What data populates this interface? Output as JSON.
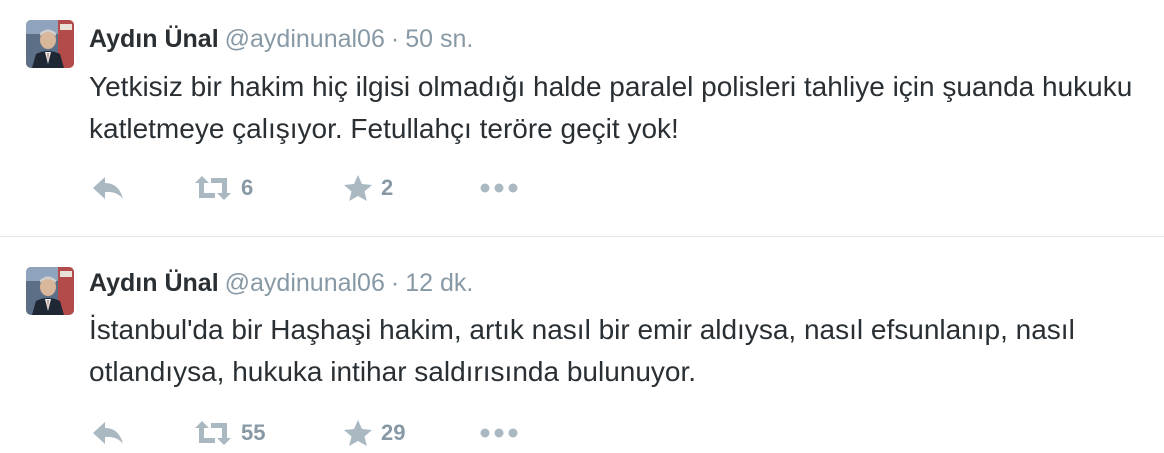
{
  "tweets": [
    {
      "fullname": "Aydın Ünal",
      "username": "@aydinunal06",
      "separator": "·",
      "time": "50 sn.",
      "text": "Yetkisiz bir hakim hiç ilgisi olmadığı halde paralel polisleri tahliye için şuanda hukuku katletmeye çalışıyor. Fetullahçı teröre geçit yok!",
      "retweet_count": "6",
      "favorite_count": "2"
    },
    {
      "fullname": "Aydın Ünal",
      "username": "@aydinunal06",
      "separator": "·",
      "time": "12 dk.",
      "text": "İstanbul'da bir Haşhaşi hakim, artık nasıl bir emir aldıysa, nasıl efsunlanıp, nasıl otlandıysa, hukuka intihar saldırısında bulunuyor.",
      "retweet_count": "55",
      "favorite_count": "29"
    }
  ],
  "icons": {
    "reply": "reply-icon",
    "retweet": "retweet-icon",
    "favorite": "star-icon",
    "more": "more-icon"
  },
  "colors": {
    "text": "#292f33",
    "secondary": "#8899a6",
    "icon": "#aab8c2",
    "divider": "#e1e8ed"
  }
}
